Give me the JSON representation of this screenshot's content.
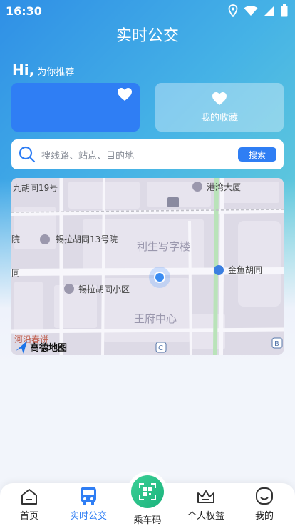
{
  "status": {
    "time": "16:30"
  },
  "header": {
    "title": "实时公交"
  },
  "greeting": {
    "hi": "Hi,",
    "sub": "为你推荐"
  },
  "cards": {
    "favorites_label": "我的收藏"
  },
  "search": {
    "placeholder": "搜线路、站点、目的地",
    "button": "搜索"
  },
  "map": {
    "labels": {
      "hutong19": "九胡同19号",
      "gangwan": "港湾大厦",
      "yuan": "院",
      "xila13": "锡拉胡同13号院",
      "lisheng": "利生写字楼",
      "tong": "同",
      "jinyu": "金鱼胡同",
      "xilaxiaoqu": "锡拉胡同小区",
      "wangfu": "王府中心",
      "shop": "河沿春饼",
      "logo": "高德地图",
      "sub_b": "B",
      "sub_c": "C"
    }
  },
  "tabbar": {
    "home": "首页",
    "realtime": "实时公交",
    "ride_code": "乘车码",
    "benefits": "个人权益",
    "mine": "我的"
  },
  "colors": {
    "primary": "#2f7ef4",
    "accent_green": "#1bb37c"
  }
}
